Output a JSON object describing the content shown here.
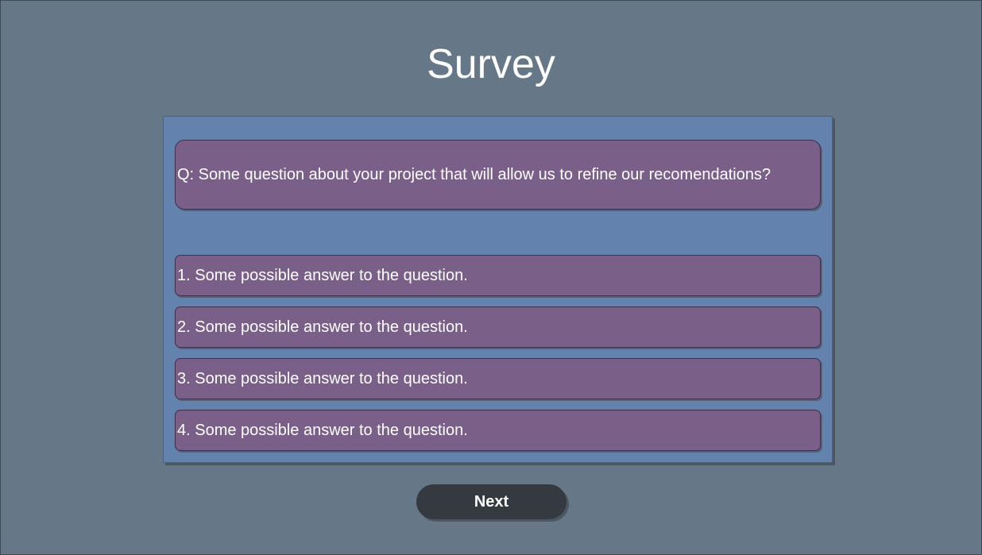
{
  "page": {
    "title": "Survey"
  },
  "survey": {
    "question": "Q: Some question about your project that will allow us to refine our recomendations?",
    "answers": [
      "1. Some possible answer to the question.",
      "2. Some possible answer to the question.",
      "3. Some possible answer to the question.",
      "4. Some possible answer to the question."
    ]
  },
  "actions": {
    "next_label": "Next"
  },
  "colors": {
    "background": "#667788",
    "panel": "#6382ad",
    "card": "#7a5f89",
    "button": "#343a40",
    "text": "#ffffff"
  }
}
